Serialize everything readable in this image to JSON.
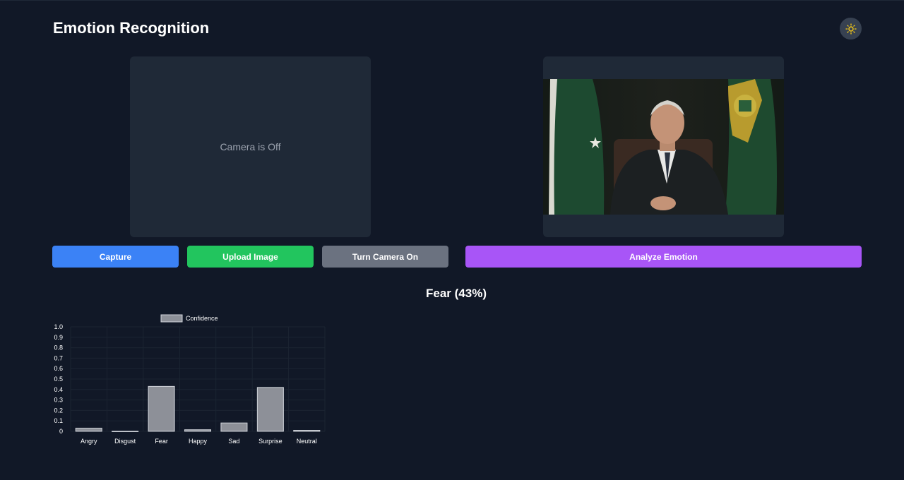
{
  "app": {
    "title": "Emotion Recognition",
    "theme_icon": "sun-icon"
  },
  "camera_panel": {
    "status_text": "Camera is Off"
  },
  "preview_panel": {
    "image_icon": "uploaded-photo"
  },
  "buttons": {
    "capture": "Capture",
    "upload": "Upload Image",
    "camera_toggle": "Turn Camera On",
    "analyze": "Analyze Emotion"
  },
  "result": {
    "text": "Fear (43%)"
  },
  "colors": {
    "background": "#111827",
    "panel": "#1f2937",
    "capture": "#3b82f6",
    "upload": "#22c55e",
    "camera": "#6b7280",
    "analyze": "#a855f7",
    "bar": "#8d9098"
  },
  "chart_data": {
    "type": "bar",
    "categories": [
      "Angry",
      "Disgust",
      "Fear",
      "Happy",
      "Sad",
      "Surprise",
      "Neutral"
    ],
    "series": [
      {
        "name": "Confidence",
        "values": [
          0.03,
          0.0,
          0.43,
          0.015,
          0.08,
          0.42,
          0.01
        ]
      }
    ],
    "ylim": [
      0,
      1
    ],
    "yticks": [
      "0",
      "0.1",
      "0.2",
      "0.3",
      "0.4",
      "0.5",
      "0.6",
      "0.7",
      "0.8",
      "0.9",
      "1.0"
    ],
    "legend": "top",
    "grid": true
  }
}
